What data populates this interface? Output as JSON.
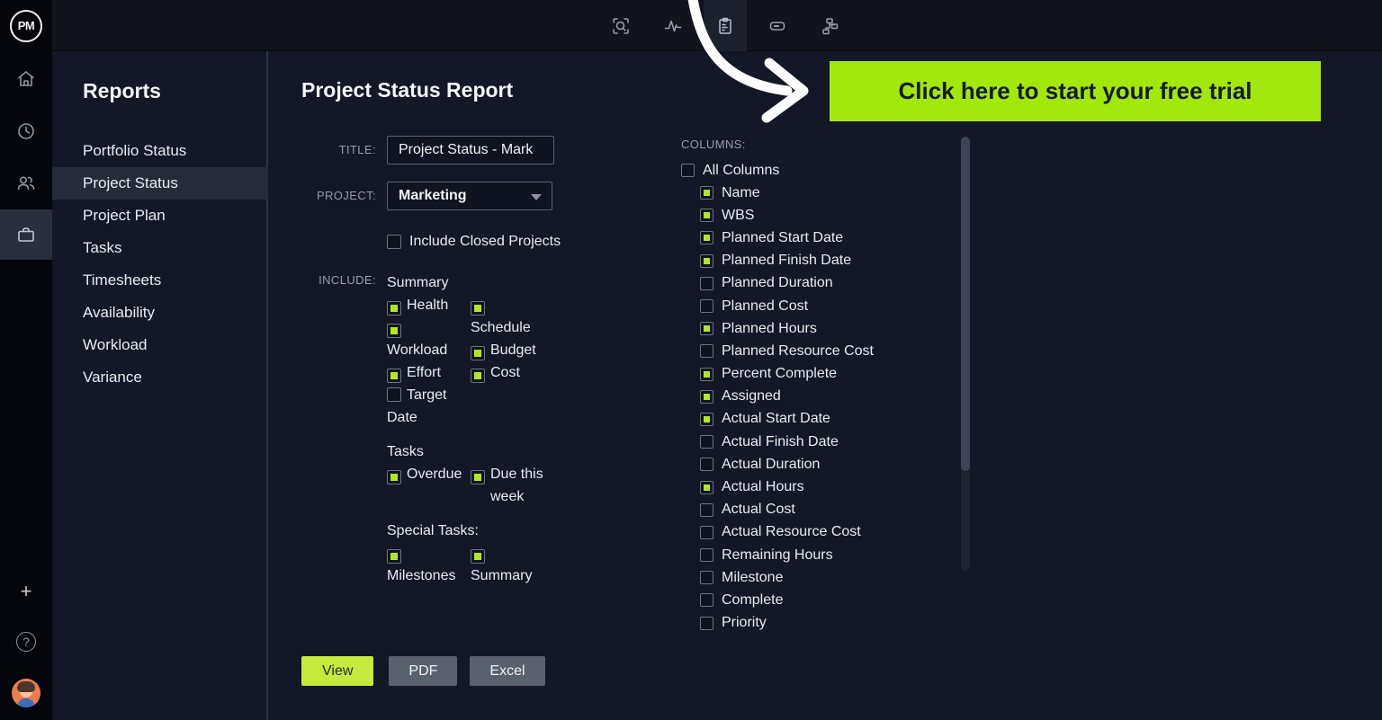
{
  "colors": {
    "accent_green": "#b2e71e",
    "banner_green": "#a4e70c",
    "view_button_green": "#c6e93e"
  },
  "topbar": {
    "icons": [
      {
        "name": "select-search-icon",
        "active": false
      },
      {
        "name": "activity-icon",
        "active": false
      },
      {
        "name": "reports-clipboard-icon",
        "active": true
      },
      {
        "name": "card-icon",
        "active": false
      },
      {
        "name": "workflow-icon",
        "active": false
      }
    ]
  },
  "rail": {
    "logo": "PM",
    "plus": "+",
    "help": "?"
  },
  "sidebar": {
    "title": "Reports",
    "items": [
      {
        "label": "Portfolio Status",
        "selected": false
      },
      {
        "label": "Project Status",
        "selected": true
      },
      {
        "label": "Project Plan",
        "selected": false
      },
      {
        "label": "Tasks",
        "selected": false
      },
      {
        "label": "Timesheets",
        "selected": false
      },
      {
        "label": "Availability",
        "selected": false
      },
      {
        "label": "Workload",
        "selected": false
      },
      {
        "label": "Variance",
        "selected": false
      }
    ]
  },
  "report": {
    "heading": "Project Status Report",
    "title_label": "TITLE:",
    "title_value": "Project Status - Mark",
    "project_label": "PROJECT:",
    "project_value": "Marketing",
    "include_closed": {
      "label": "Include Closed Projects",
      "checked": false
    },
    "include_label": "INCLUDE:",
    "include_groups": [
      {
        "heading": "Summary",
        "columns": [
          [
            {
              "label": "Health",
              "checked": true
            },
            {
              "label": "Workload",
              "checked": true,
              "wrap": "below"
            },
            {
              "label": "Effort",
              "checked": true
            },
            {
              "label": "Target\nDate",
              "checked": false
            }
          ],
          [
            {
              "label": "Schedule",
              "checked": true,
              "wrap": "below"
            },
            {
              "label": "Budget",
              "checked": true
            },
            {
              "label": "Cost",
              "checked": true
            }
          ]
        ]
      },
      {
        "heading": "Tasks",
        "columns": [
          [
            {
              "label": "Overdue",
              "checked": true
            }
          ],
          [
            {
              "label": "Due this\nweek",
              "checked": true,
              "wrap": "hang"
            }
          ]
        ]
      },
      {
        "heading": "Special Tasks:",
        "columns": [
          [
            {
              "label": "Milestones",
              "checked": true,
              "wrap": "below"
            }
          ],
          [
            {
              "label": "Summary",
              "checked": true,
              "wrap": "below"
            }
          ]
        ]
      }
    ],
    "buttons": [
      {
        "label": "View",
        "variant": "primary"
      },
      {
        "label": "PDF",
        "variant": "secondary"
      },
      {
        "label": "Excel",
        "variant": "secondary"
      }
    ]
  },
  "columns_panel": {
    "label": "COLUMNS:",
    "all_columns": {
      "label": "All Columns",
      "checked": false
    },
    "items": [
      {
        "label": "Name",
        "checked": true
      },
      {
        "label": "WBS",
        "checked": true
      },
      {
        "label": "Planned Start Date",
        "checked": true
      },
      {
        "label": "Planned Finish Date",
        "checked": true
      },
      {
        "label": "Planned Duration",
        "checked": false
      },
      {
        "label": "Planned Cost",
        "checked": false
      },
      {
        "label": "Planned Hours",
        "checked": true
      },
      {
        "label": "Planned Resource Cost",
        "checked": false
      },
      {
        "label": "Percent Complete",
        "checked": true
      },
      {
        "label": "Assigned",
        "checked": true
      },
      {
        "label": "Actual Start Date",
        "checked": true
      },
      {
        "label": "Actual Finish Date",
        "checked": false
      },
      {
        "label": "Actual Duration",
        "checked": false
      },
      {
        "label": "Actual Hours",
        "checked": true
      },
      {
        "label": "Actual Cost",
        "checked": false
      },
      {
        "label": "Actual Resource Cost",
        "checked": false
      },
      {
        "label": "Remaining Hours",
        "checked": false
      },
      {
        "label": "Milestone",
        "checked": false
      },
      {
        "label": "Complete",
        "checked": false
      },
      {
        "label": "Priority",
        "checked": false
      }
    ]
  },
  "banner": {
    "text": "Click here to start your free trial"
  }
}
